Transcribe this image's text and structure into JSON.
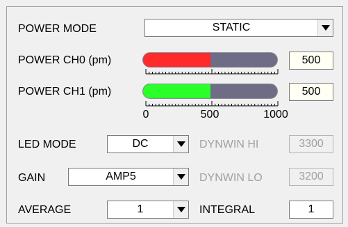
{
  "power_mode": {
    "label": "POWER MODE",
    "value": "STATIC"
  },
  "power_ch0": {
    "label": "POWER CH0 (pm)",
    "value": "500",
    "level": 0.5,
    "color": "#ff2a2a"
  },
  "power_ch1": {
    "label": "POWER CH1 (pm)",
    "value": "500",
    "level": 0.5,
    "color": "#2aff2a"
  },
  "scale": {
    "ticks": [
      "0",
      "500",
      "1000"
    ]
  },
  "led_mode": {
    "label": "LED MODE",
    "value": "DC"
  },
  "gain": {
    "label": "GAIN",
    "value": "AMP5"
  },
  "average": {
    "label": "AVERAGE",
    "value": "1"
  },
  "dynwin_hi": {
    "label": "DYNWIN HI",
    "value": "3300"
  },
  "dynwin_lo": {
    "label": "DYNWIN LO",
    "value": "3200"
  },
  "integral": {
    "label": "INTEGRAL",
    "value": "1"
  },
  "colors": {
    "track": "#6f6d86",
    "field_bg": "#fffff4",
    "disabled_text": "#a0a0a0"
  }
}
